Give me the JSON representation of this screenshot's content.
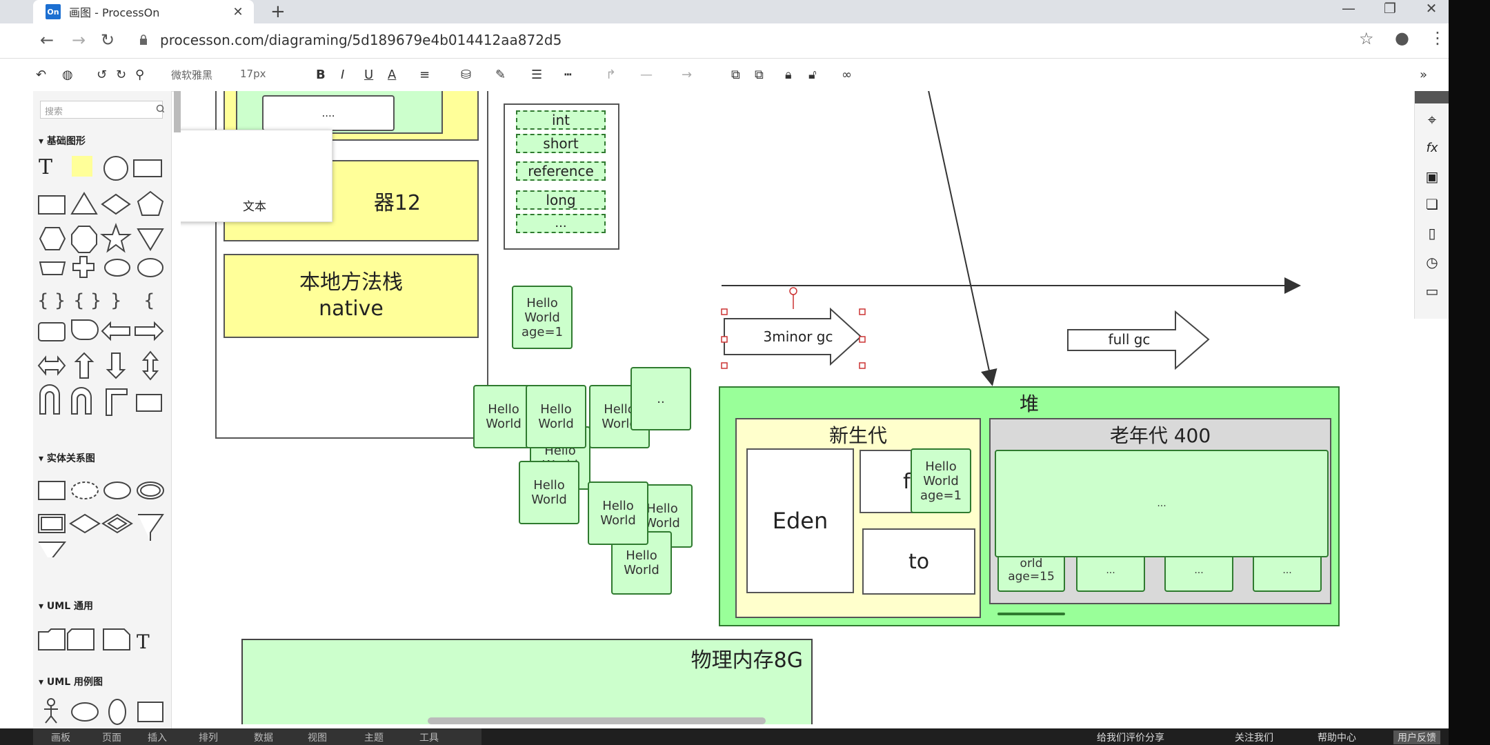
{
  "browser": {
    "tab_title": "画图 - ProcessOn",
    "tab_logo": "On",
    "url": "processon.com/diagraming/5d189679e4b014412aa872d5"
  },
  "toolbar": {
    "font_family": "微软雅黑",
    "font_size": "17px",
    "bold": "B",
    "italic": "I",
    "underline": "U",
    "font_color": "A"
  },
  "sidebar": {
    "search_placeholder": "搜索",
    "sections": [
      "基础图形",
      "实体关系图",
      "UML 通用",
      "UML 用例图"
    ],
    "tooltip_text": "文本"
  },
  "diagram": {
    "pc_register": "器12",
    "native_stack": [
      "本地方法栈",
      "native"
    ],
    "ellipsis_small": "....",
    "types": [
      "int",
      "short",
      "reference",
      "long",
      "..."
    ],
    "hello_world": [
      "Hello",
      "World"
    ],
    "age1": "age=1",
    "dots": "..",
    "minor_gc": "3minor gc",
    "full_gc": "full gc",
    "heap": "堆",
    "young_gen": "新生代",
    "old_gen": "老年代 400",
    "eden": "Eden",
    "from_partial": "fr",
    "to": "to",
    "old_ellipsis": "...",
    "old_small": [
      "orld",
      "age=15"
    ],
    "old_small_dots": "...",
    "physical_memory": "物理内存8G"
  },
  "bottom": {
    "menu": [
      "画板",
      "页面",
      "插入",
      "排列",
      "数据",
      "视图",
      "主题",
      "工具"
    ],
    "right_items": [
      "给我们评价分享",
      "关注我们",
      "帮助中心",
      "用户反馈"
    ]
  },
  "colors": {
    "green_fill": "#ccffcc",
    "heap_fill": "#99ff99",
    "yellow_fill": "#ffff99",
    "gray_fill": "#d9d9d9"
  }
}
